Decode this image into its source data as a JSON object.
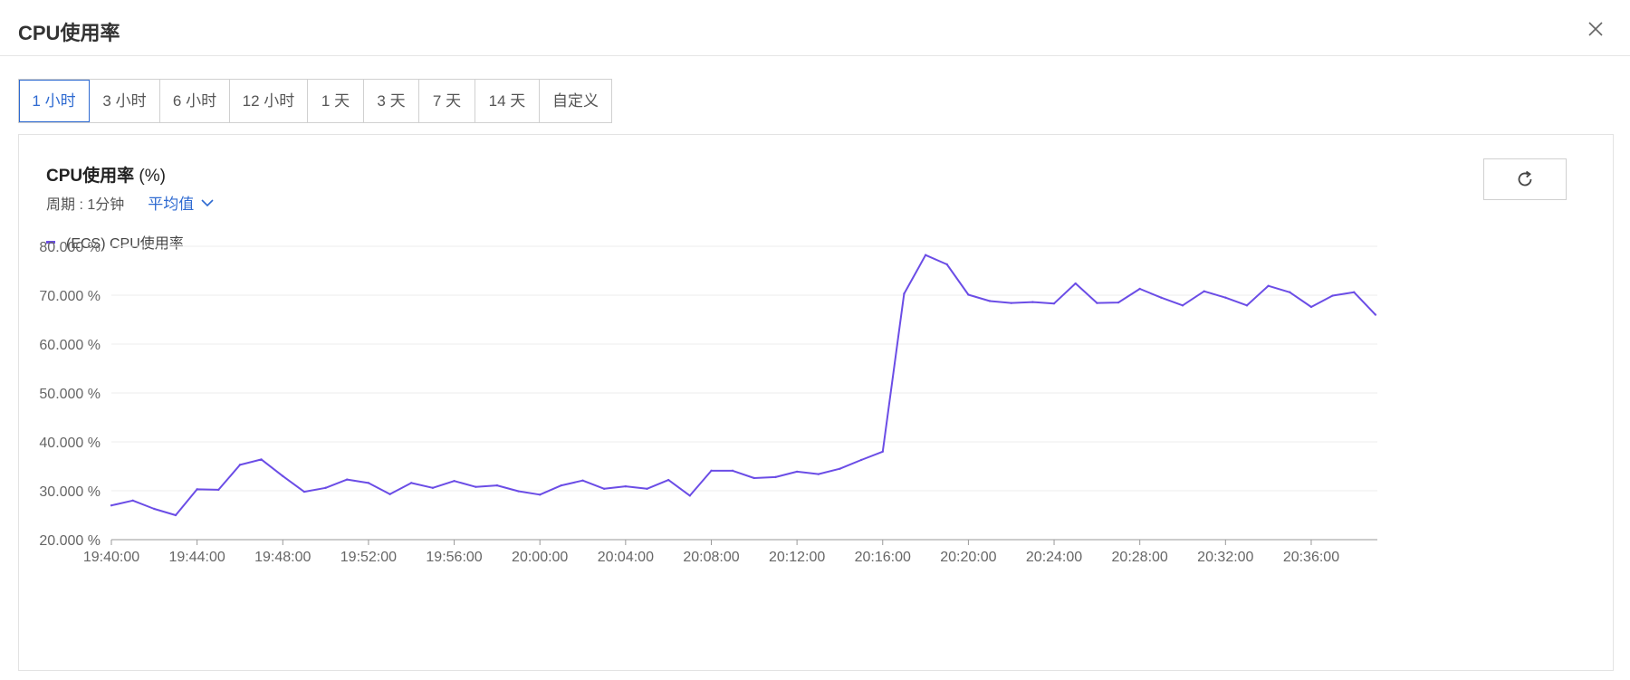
{
  "dialog": {
    "title": "CPU使用率"
  },
  "range_tabs": [
    "1 小时",
    "3 小时",
    "6 小时",
    "12 小时",
    "1 天",
    "3 天",
    "7 天",
    "14 天",
    "自定义"
  ],
  "active_tab": "1 小时",
  "panel": {
    "title": "CPU使用率",
    "unit": "(%)",
    "period": "周期 : 1分钟",
    "aggregation": "平均值",
    "legend": "(ECS) CPU使用率"
  },
  "icons": {
    "close": "close-icon",
    "refresh": "refresh-icon",
    "dropdown": "chevron-down-icon"
  },
  "colors": {
    "series": "#6b4de6",
    "accent": "#2e6ad1"
  },
  "chart_data": {
    "type": "line",
    "title": "CPU使用率 (%)",
    "xlabel": "",
    "ylabel": "",
    "ylim": [
      20,
      80
    ],
    "yticks": [
      "20.000 %",
      "30.000 %",
      "40.000 %",
      "50.000 %",
      "60.000 %",
      "70.000 %",
      "80.000 %"
    ],
    "ytick_values": [
      20,
      30,
      40,
      50,
      60,
      70,
      80
    ],
    "xticks": [
      "19:40:00",
      "19:44:00",
      "19:48:00",
      "19:52:00",
      "19:56:00",
      "20:00:00",
      "20:04:00",
      "20:08:00",
      "20:12:00",
      "20:16:00",
      "20:20:00",
      "20:24:00",
      "20:28:00",
      "20:32:00",
      "20:36:00"
    ],
    "x_start": "19:40:00",
    "x_end": "20:39:00",
    "x_interval": "1分钟",
    "grid": true,
    "legend_position": "top-left",
    "series": [
      {
        "name": "(ECS) CPU使用率",
        "values": [
          27.0,
          28.0,
          26.3,
          25.0,
          30.3,
          30.2,
          35.3,
          36.4,
          33.0,
          29.8,
          30.6,
          32.3,
          31.6,
          29.3,
          31.6,
          30.6,
          32.0,
          30.8,
          31.1,
          29.9,
          29.2,
          31.1,
          32.1,
          30.4,
          30.9,
          30.4,
          32.2,
          29.0,
          34.1,
          34.1,
          32.6,
          32.8,
          33.9,
          33.4,
          34.5,
          36.3,
          38.0,
          70.3,
          78.2,
          76.3,
          70.1,
          68.8,
          68.4,
          68.6,
          68.3,
          72.4,
          68.4,
          68.5,
          71.3,
          69.5,
          67.9,
          70.8,
          69.5,
          67.9,
          71.9,
          70.6,
          67.6,
          69.9,
          70.6,
          66.0
        ]
      }
    ]
  }
}
